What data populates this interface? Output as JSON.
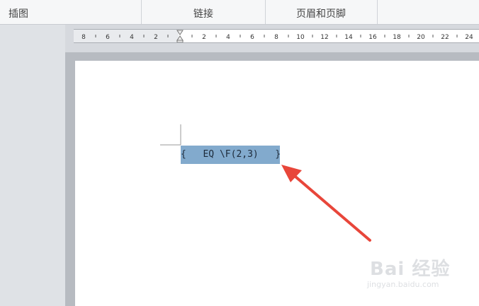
{
  "ribbon": {
    "groups": [
      "插图",
      "链接",
      "页眉和页脚"
    ]
  },
  "ruler": {
    "left_labels": [
      "8",
      "6",
      "4",
      "2"
    ],
    "right_labels": [
      "2",
      "4",
      "6",
      "8",
      "10",
      "12",
      "14",
      "16",
      "18",
      "20",
      "22",
      "24"
    ]
  },
  "document": {
    "field_code": "{ EQ \\F(2,3) }",
    "field_open": "{",
    "field_body": "EQ \\F(2,3)",
    "field_close": "}"
  },
  "watermark": {
    "brand": "Bai 经验",
    "site": "jingyan.baidu.com"
  },
  "colors": {
    "field_highlight": "#82aacd",
    "field_tail": "#a9cdee",
    "arrow": "#e8463a",
    "page_background": "#ffffff",
    "workspace": "#d6d9de"
  }
}
